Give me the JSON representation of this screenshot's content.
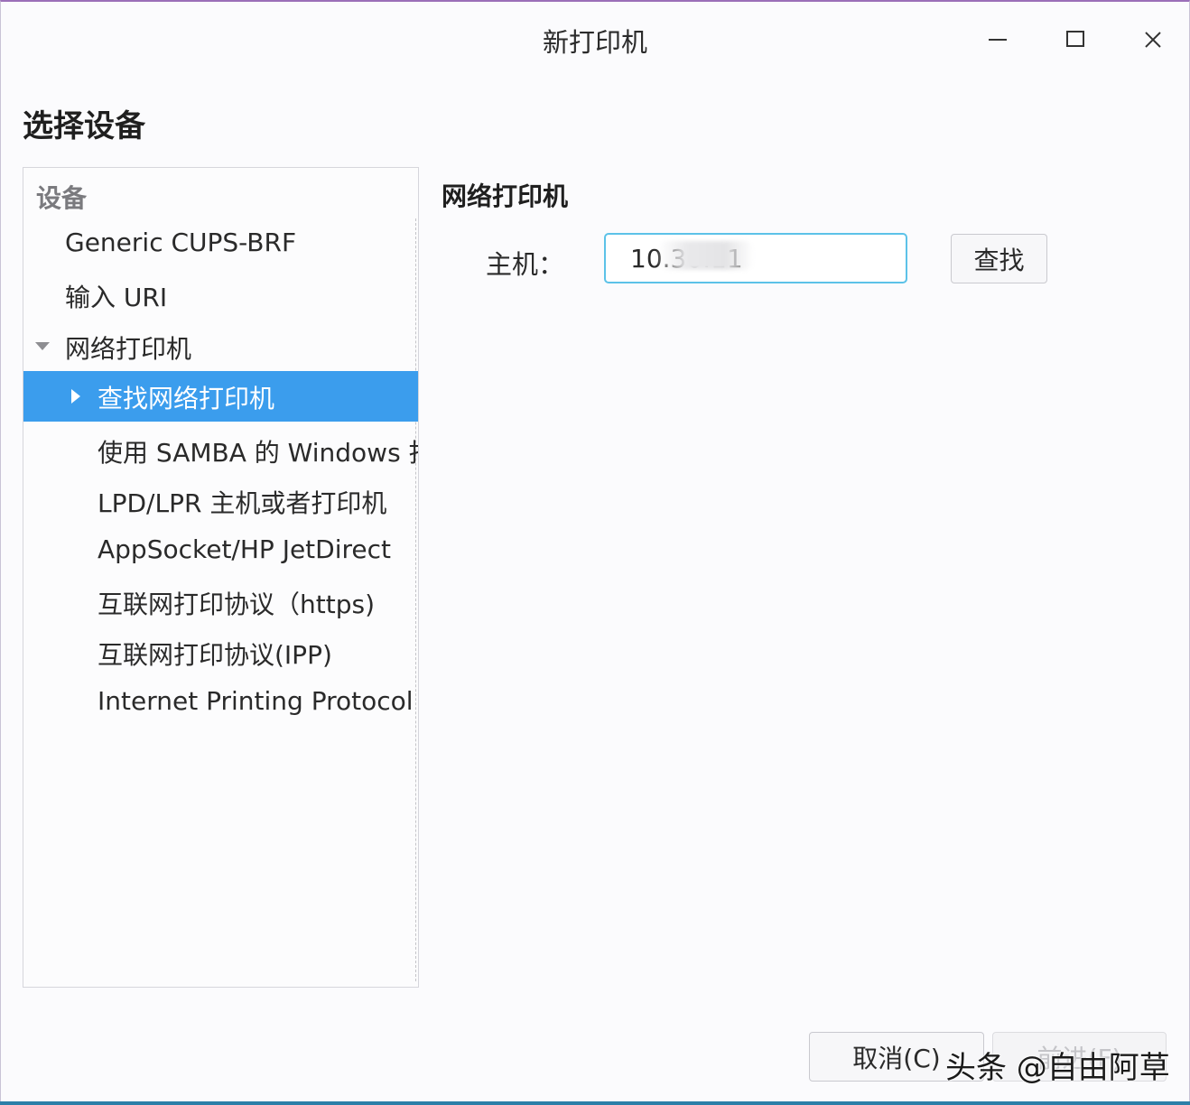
{
  "window": {
    "title": "新打印机"
  },
  "page": {
    "heading": "选择设备"
  },
  "device_tree": {
    "header": "设备",
    "items": [
      {
        "label": "Generic CUPS-BRF",
        "level": 0
      },
      {
        "label": "输入 URI",
        "level": 0
      },
      {
        "label": "网络打印机",
        "level": 0,
        "expanded": true
      },
      {
        "label": "查找网络打印机",
        "level": 1,
        "selected": true
      },
      {
        "label": "使用 SAMBA 的 Windows 打印机",
        "level": 1
      },
      {
        "label": "LPD/LPR 主机或者打印机",
        "level": 1
      },
      {
        "label": "AppSocket/HP JetDirect",
        "level": 1
      },
      {
        "label": "互联网打印协议（https)",
        "level": 1
      },
      {
        "label": "互联网打印协议(IPP)",
        "level": 1
      },
      {
        "label": "Internet Printing Protocol (ipps)",
        "level": 1
      }
    ]
  },
  "network_printer": {
    "title": "网络打印机",
    "host_label": "主机：",
    "host_value": "10.30.11",
    "find_button": "查找"
  },
  "footer": {
    "cancel_button": "取消(C)",
    "forward_button": "前进(F)"
  },
  "watermark": {
    "text": "头条 @自由阿草"
  },
  "colors": {
    "selection": "#3b9ded",
    "input_focus_border": "#5cc2e8",
    "window_accent": "#9b6fb8"
  }
}
